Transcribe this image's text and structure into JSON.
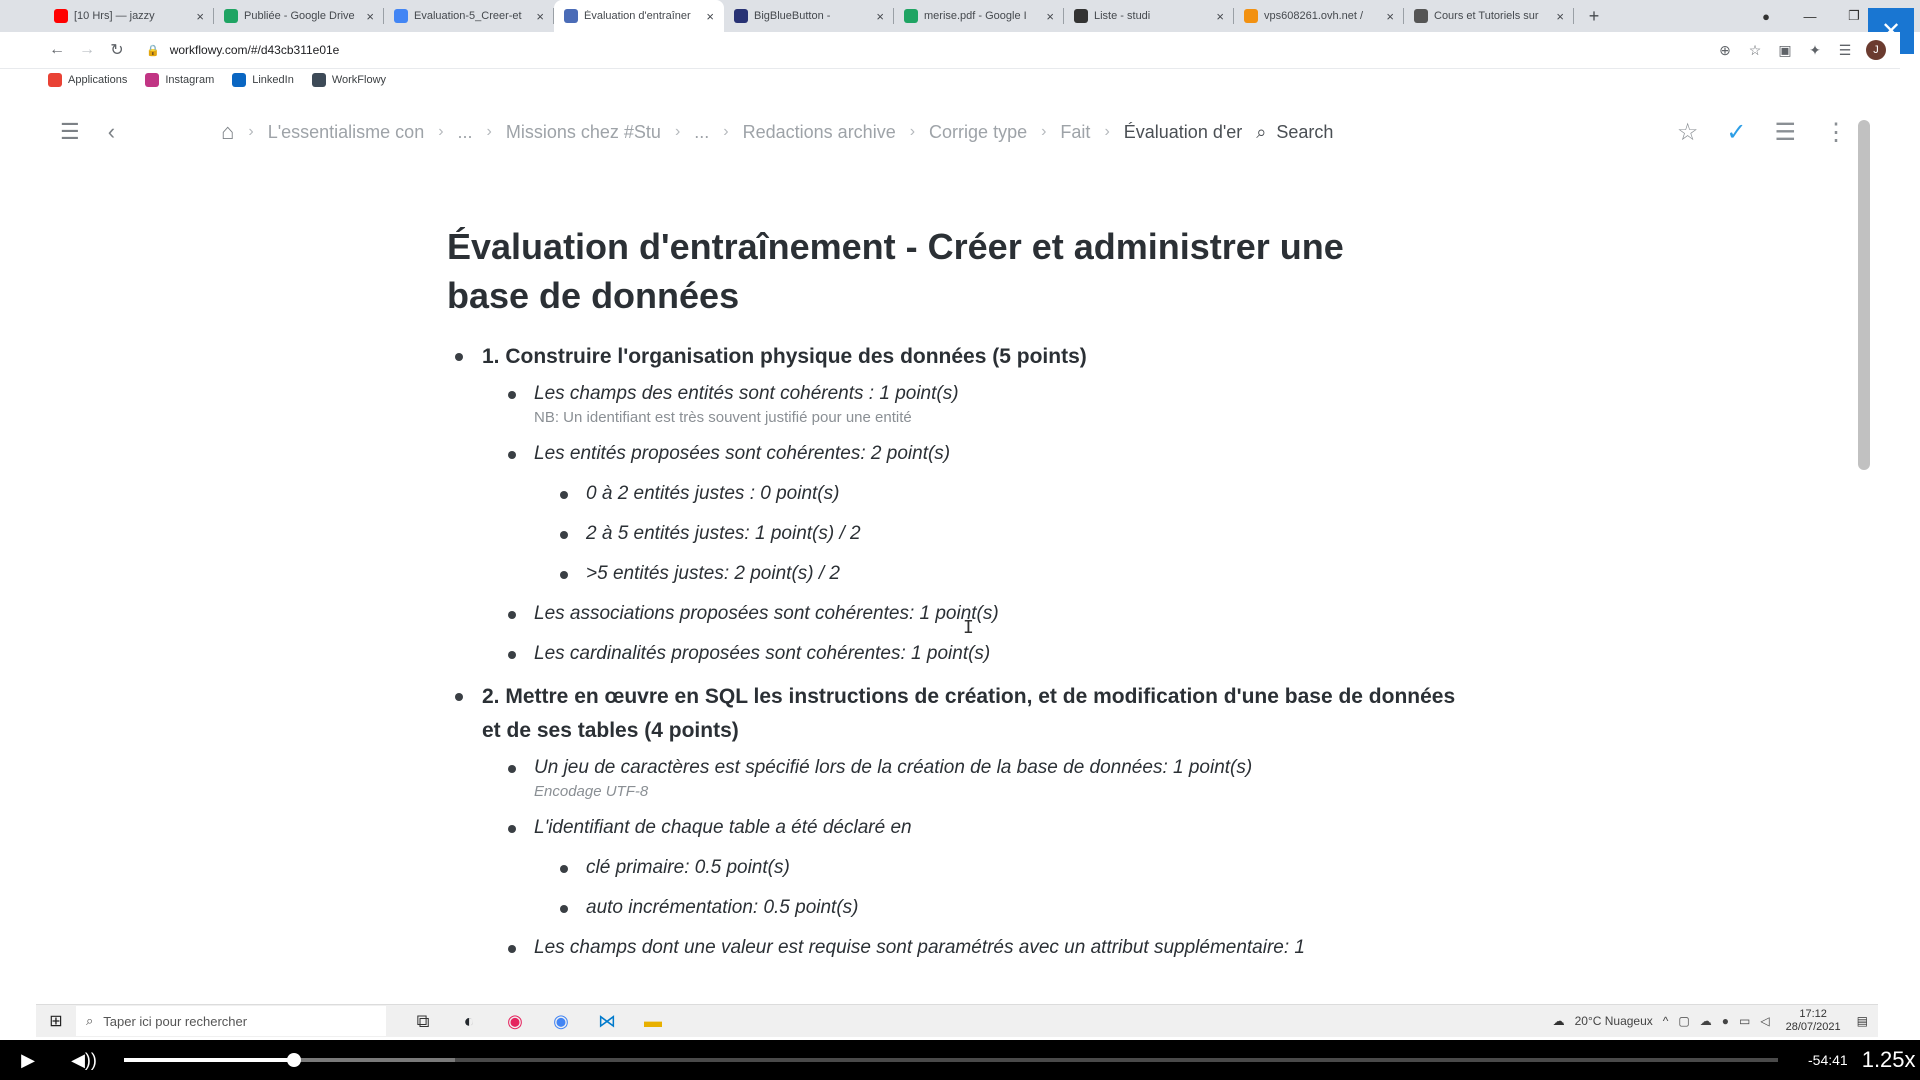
{
  "browser": {
    "tabs": [
      {
        "title": "[10 Hrs] — jazzy",
        "favicon_color": "#ff0000",
        "active": false
      },
      {
        "title": "Publiée - Google Drive",
        "favicon_color": "#1fa463",
        "active": false
      },
      {
        "title": "Evaluation-5_Creer-et",
        "favicon_color": "#4285f4",
        "active": false
      },
      {
        "title": "Évaluation d'entraîner",
        "favicon_color": "#4b6cb7",
        "active": true
      },
      {
        "title": "BigBlueButton - ",
        "favicon_color": "#283274",
        "active": false
      },
      {
        "title": "merise.pdf - Google I",
        "favicon_color": "#1fa463",
        "active": false
      },
      {
        "title": "Liste - studi",
        "favicon_color": "#333333",
        "active": false
      },
      {
        "title": "vps608261.ovh.net /",
        "favicon_color": "#f29111",
        "active": false
      },
      {
        "title": "Cours et Tutoriels sur",
        "favicon_color": "#555555",
        "active": false
      }
    ],
    "new_tab_label": "+",
    "url": "workflowy.com/#/d43cb311e01e",
    "bookmarks": [
      {
        "label": "Applications",
        "color": "#e94235"
      },
      {
        "label": "Instagram",
        "color": "#c13584"
      },
      {
        "label": "LinkedIn",
        "color": "#0a66c2"
      },
      {
        "label": "WorkFlowy",
        "color": "#3d4a57"
      }
    ]
  },
  "workflowy": {
    "breadcrumbs": [
      {
        "label": "L'essentialisme con"
      },
      {
        "label": "..."
      },
      {
        "label": "Missions chez #Stu"
      },
      {
        "label": "..."
      },
      {
        "label": "Redactions archive"
      },
      {
        "label": "Corrige type"
      },
      {
        "label": "Fait"
      }
    ],
    "current_crumb": "Évaluation d'er",
    "search_label": "Search"
  },
  "document": {
    "title": "Évaluation d'entraînement - Créer et administrer une base de données",
    "sections": [
      {
        "text": "1. Construire l'organisation physique des données (5 points)",
        "items": [
          {
            "text": "Les champs des entités sont cohérents : 1 point(s)",
            "note": "NB: Un identifiant est très souvent justifié pour une entité"
          },
          {
            "text": "Les entités proposées sont cohérentes: 2 point(s)",
            "children": [
              "0 à 2 entités justes : 0 point(s)",
              "2 à 5 entités justes: 1 point(s) / 2",
              ">5 entités justes:  2 point(s) / 2"
            ]
          },
          {
            "text": "Les associations proposées sont cohérentes: 1 point(s)"
          },
          {
            "text": "Les cardinalités proposées sont cohérentes: 1 point(s)"
          }
        ]
      },
      {
        "text": "2. Mettre en œuvre en SQL les instructions de création, et de modification d'une base de données et de ses tables (4 points)",
        "items": [
          {
            "text": "Un jeu de caractères est spécifié lors de la création de la base de données: 1 point(s)",
            "note": "Encodage UTF-8"
          },
          {
            "text": "L'identifiant de chaque table a été déclaré en",
            "children": [
              "clé primaire: 0.5 point(s)",
              "auto incrémentation: 0.5 point(s)"
            ]
          },
          {
            "text": "Les champs dont une valeur est requise sont paramétrés avec un attribut supplémentaire:  1"
          }
        ]
      }
    ]
  },
  "taskbar": {
    "search_placeholder": "Taper ici pour rechercher",
    "weather": "20°C  Nuageux",
    "time": "17:12",
    "date": "28/07/2021"
  },
  "player": {
    "played_fraction": 0.103,
    "buffered_fraction": 0.2,
    "remaining": "-54:41",
    "speed": "1.25x"
  },
  "colors": {
    "accent_check": "#2c9ee6",
    "fullscreen_button": "#1976d2"
  }
}
